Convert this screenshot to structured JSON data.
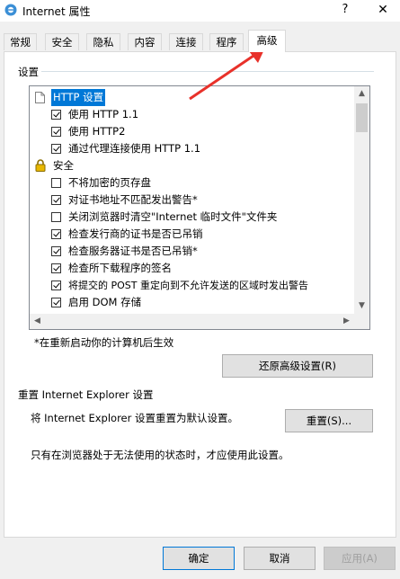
{
  "window": {
    "title": "Internet 属性",
    "help": "?",
    "close": "✕"
  },
  "tabs": [
    {
      "label": "常规"
    },
    {
      "label": "安全"
    },
    {
      "label": "隐私"
    },
    {
      "label": "内容"
    },
    {
      "label": "连接"
    },
    {
      "label": "程序"
    },
    {
      "label": "高级",
      "active": true
    }
  ],
  "settings": {
    "group_label": "设置",
    "items": [
      {
        "type": "header",
        "icon": "page-icon",
        "label": "HTTP 设置",
        "selected": true
      },
      {
        "type": "checkbox",
        "checked": true,
        "label": "使用 HTTP 1.1"
      },
      {
        "type": "checkbox",
        "checked": true,
        "label": "使用 HTTP2"
      },
      {
        "type": "checkbox",
        "checked": true,
        "label": "通过代理连接使用 HTTP 1.1"
      },
      {
        "type": "header",
        "icon": "lock-icon",
        "label": "安全"
      },
      {
        "type": "checkbox",
        "checked": false,
        "label": "不将加密的页存盘"
      },
      {
        "type": "checkbox",
        "checked": true,
        "label": "对证书地址不匹配发出警告*"
      },
      {
        "type": "checkbox",
        "checked": false,
        "label": "关闭浏览器时清空\"Internet 临时文件\"文件夹"
      },
      {
        "type": "checkbox",
        "checked": true,
        "label": "检查发行商的证书是否已吊销"
      },
      {
        "type": "checkbox",
        "checked": true,
        "label": "检查服务器证书是否已吊销*"
      },
      {
        "type": "checkbox",
        "checked": true,
        "label": "检查所下载程序的签名"
      },
      {
        "type": "checkbox",
        "checked": true,
        "label": "将提交的 POST 重定向到不允许发送的区域时发出警告"
      },
      {
        "type": "checkbox",
        "checked": true,
        "label": "启用 DOM 存储"
      }
    ],
    "restart_note": "*在重新启动你的计算机后生效",
    "restore_button": "还原高级设置(R)"
  },
  "reset": {
    "heading": "重置 Internet Explorer 设置",
    "description": "将 Internet Explorer 设置重置为默认设置。",
    "button": "重置(S)...",
    "note": "只有在浏览器处于无法使用的状态时，才应使用此设置。"
  },
  "footer": {
    "ok": "确定",
    "cancel": "取消",
    "apply": "应用(A)"
  },
  "colors": {
    "selection": "#0078d7",
    "annotation_arrow": "#e8312a"
  }
}
